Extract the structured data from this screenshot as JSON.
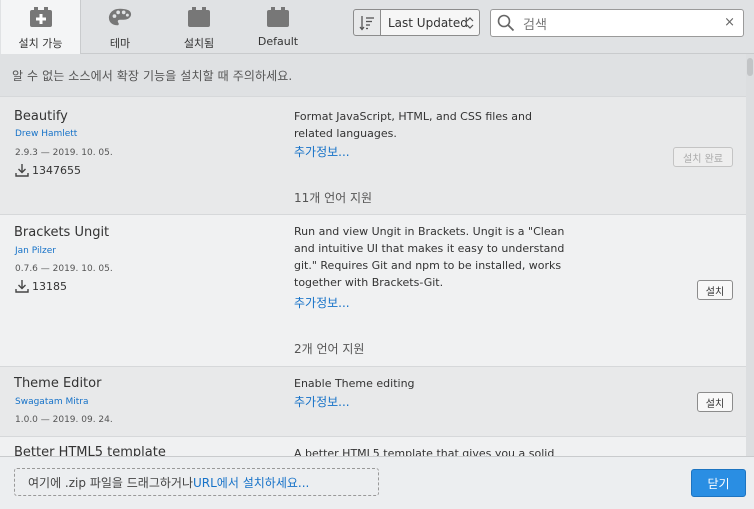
{
  "tabs": [
    {
      "label": "설치 가능",
      "icon": "plus-box-icon",
      "active": true
    },
    {
      "label": "테마",
      "icon": "palette-icon",
      "active": false
    },
    {
      "label": "설치됨",
      "icon": "box-icon",
      "active": false
    },
    {
      "label": "Default",
      "icon": "box-icon",
      "active": false
    }
  ],
  "sort": {
    "label": "Last Updated"
  },
  "search": {
    "placeholder": "검색",
    "clear": "×"
  },
  "warning": "알 수 없는 소스에서 확장 기능을 설치할 때 주의하세요.",
  "extensions": [
    {
      "title": "Beautify",
      "author": "Drew Hamlett",
      "version": "2.9.3 — 2019. 10. 05.",
      "downloads": "1347655",
      "description": "Format JavaScript, HTML, and CSS files and related languages.",
      "more": "추가정보...",
      "languages": "11개 언어 지원",
      "button": "설치 완료",
      "installed": true
    },
    {
      "title": "Brackets Ungit",
      "author": "Jan Pilzer",
      "version": "0.7.6 — 2019. 10. 05.",
      "downloads": "13185",
      "description": "Run and view Ungit in Brackets. Ungit is a \"Clean and intuitive UI that makes it easy to understand git.\" Requires Git and npm to be installed, works together with Brackets-Git.",
      "more": "추가정보...",
      "languages": "2개 언어 지원",
      "button": "설치",
      "installed": false
    },
    {
      "title": "Theme Editor",
      "author": "Swagatam Mitra",
      "version": "1.0.0 — 2019. 09. 24.",
      "downloads": "",
      "description": "Enable Theme editing",
      "more": "추가정보...",
      "languages": "",
      "button": "설치",
      "installed": false
    },
    {
      "title": "Better HTML5 template",
      "author": "",
      "version": "",
      "downloads": "",
      "description": "A better HTML5 template that gives you a solid",
      "more": "",
      "languages": "",
      "button": "",
      "installed": false
    }
  ],
  "footer": {
    "drop_prefix": "여기에 .zip 파일을 드래그하거나 ",
    "drop_link": "URL에서 설치하세요...",
    "close_label": "닫기"
  },
  "colors": {
    "accent": "#2a8ee3",
    "link": "#1672c8"
  }
}
